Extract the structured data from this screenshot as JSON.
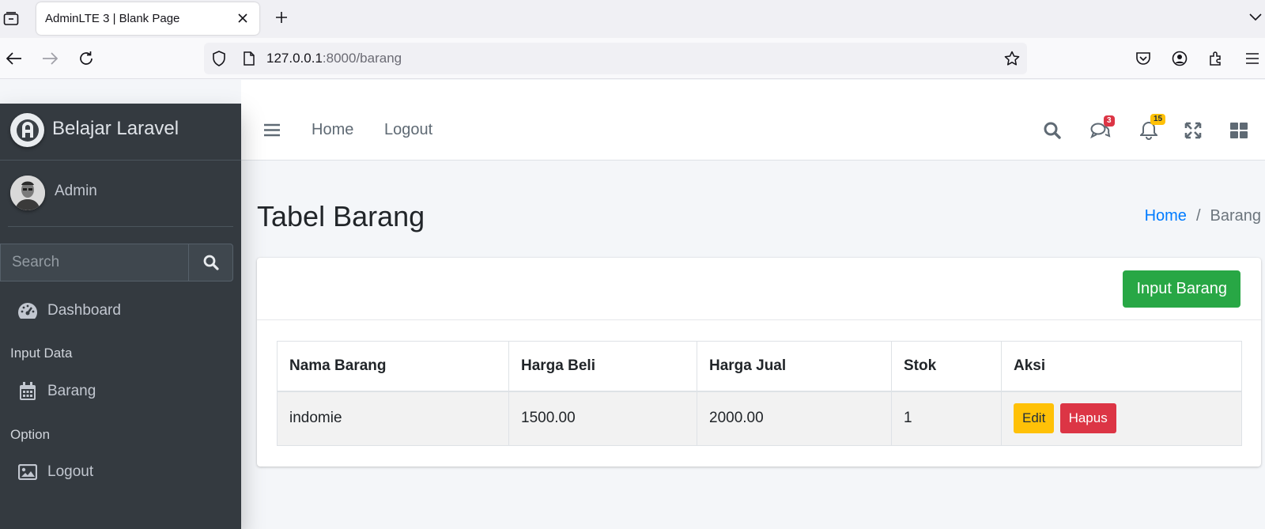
{
  "browser": {
    "tab_title": "AdminLTE 3 | Blank Page",
    "url_host": "127.0.0.1",
    "url_rest": ":8000/barang"
  },
  "sidebar": {
    "brand": "Belajar Laravel",
    "user": "Admin",
    "search_placeholder": "Search",
    "items": [
      {
        "label": "Dashboard",
        "icon": "tachometer-icon"
      },
      {
        "header": "Input Data"
      },
      {
        "label": "Barang",
        "icon": "calendar-icon"
      },
      {
        "header": "Option"
      },
      {
        "label": "Logout",
        "icon": "image-icon"
      }
    ]
  },
  "navbar": {
    "links": [
      "Home",
      "Logout"
    ],
    "messages_badge": "3",
    "notifications_badge": "15",
    "colors": {
      "danger": "#dc3545",
      "warning": "#ffc107"
    }
  },
  "page": {
    "title": "Tabel Barang",
    "breadcrumb": {
      "home": "Home",
      "sep": "/",
      "active": "Barang"
    }
  },
  "card": {
    "input_button": "Input Barang",
    "table": {
      "headers": [
        "Nama Barang",
        "Harga Beli",
        "Harga Jual",
        "Stok",
        "Aksi"
      ],
      "rows": [
        {
          "nama": "indomie",
          "beli": "1500.00",
          "jual": "2000.00",
          "stok": "1"
        }
      ],
      "actions": {
        "edit": "Edit",
        "hapus": "Hapus"
      }
    }
  },
  "colors": {
    "sidebar": "#343a40",
    "primary": "#007bff",
    "success": "#28a745"
  }
}
